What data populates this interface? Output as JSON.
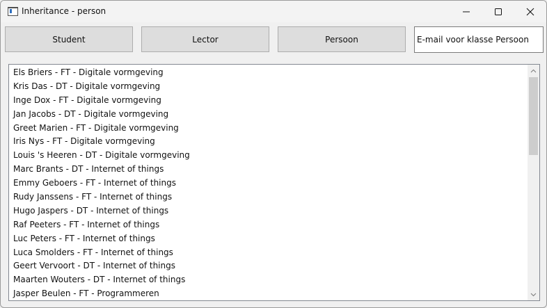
{
  "window": {
    "title": "Inheritance - person"
  },
  "buttons": {
    "student": "Student",
    "lector": "Lector",
    "persoon": "Persoon"
  },
  "email_input": {
    "value": "E-mail voor klasse Persoon"
  },
  "list": {
    "items": [
      "Els Briers - FT - Digitale vormgeving",
      "Kris Das - DT - Digitale vormgeving",
      "Inge Dox - FT - Digitale vormgeving",
      "Jan Jacobs - DT - Digitale vormgeving",
      "Greet Marien - FT - Digitale vormgeving",
      "Iris Nys - FT - Digitale vormgeving",
      "Louis 's Heeren - DT - Digitale vormgeving",
      "Marc Brants - DT - Internet of things",
      "Emmy Geboers - FT - Internet of things",
      "Rudy Janssens - FT - Internet of things",
      "Hugo Jaspers - DT - Internet of things",
      "Raf Peeters - FT - Internet of things",
      "Luc Peters - FT - Internet of things",
      "Luca Smolders - FT - Internet of things",
      "Geert Vervoort - DT - Internet of things",
      "Maarten Wouters - DT - Internet of things",
      "Jasper Beulen - FT - Programmeren"
    ]
  }
}
